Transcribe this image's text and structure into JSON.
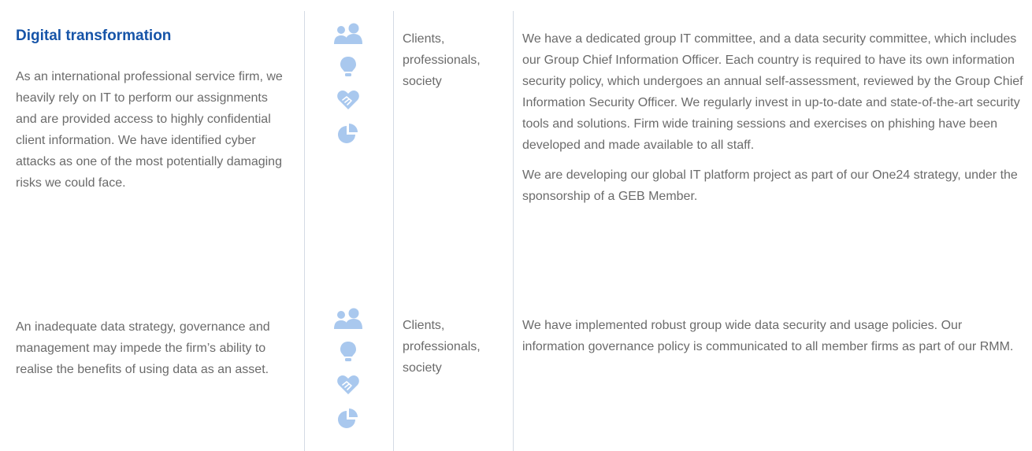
{
  "section": {
    "title": "Digital transformation"
  },
  "risks": [
    {
      "description": "As an international professional service firm, we heavily rely on IT to perform our assignments and are provided access to highly confidential client information. We have identified cyber attacks as one of the most potentially damaging risks we could face.",
      "icons": [
        "people-icon",
        "lightbulb-icon",
        "handshake-heart-icon",
        "pie-chart-icon"
      ],
      "stakeholders": "Clients, professionals, society",
      "measures": [
        "We have a dedicated group IT committee, and a data security committee, which includes our Group Chief Information Officer. Each country is required to have its own information security policy, which undergoes an annual self-assessment, reviewed by the Group Chief Information Security Officer. We regularly invest in up-to-date and state-of-the-art security tools and solutions. Firm wide training sessions and exercises on phishing have been developed and made available to all staff.",
        "We are developing our global IT platform project as part of our One24 strategy, under the sponsorship of a GEB Member."
      ]
    },
    {
      "description": "An inadequate data strategy, governance and management may impede the firm’s ability to realise the benefits of using data as an asset.",
      "icons": [
        "people-icon",
        "lightbulb-icon",
        "handshake-heart-icon",
        "pie-chart-icon"
      ],
      "stakeholders": "Clients, professionals, society",
      "measures": [
        "We have implemented robust group wide data security and usage policies. Our information governance policy is communicated to all member firms as part of our RMM."
      ]
    }
  ],
  "colors": {
    "title": "#1654a8",
    "icon": "#a9c8ee",
    "body_text": "#6b6b6b",
    "divider": "#d4dbe4"
  }
}
